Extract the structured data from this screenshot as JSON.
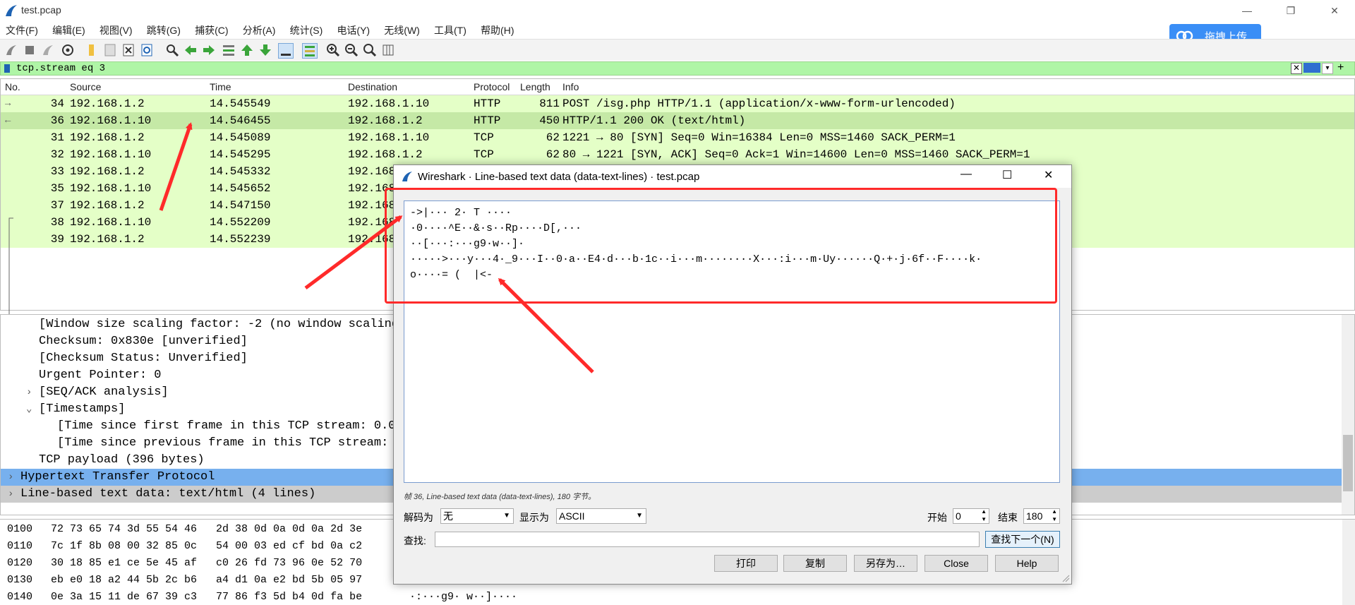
{
  "window": {
    "title": "test.pcap",
    "controls": [
      "—",
      "❐",
      "✕"
    ]
  },
  "menu": [
    "文件(F)",
    "编辑(E)",
    "视图(V)",
    "跳转(G)",
    "捕获(C)",
    "分析(A)",
    "统计(S)",
    "电话(Y)",
    "无线(W)",
    "工具(T)",
    "帮助(H)"
  ],
  "upload_button": "拖拽上传",
  "filter": {
    "value": "tcp.stream eq 3"
  },
  "packet_list": {
    "columns": [
      "No.",
      "Source",
      "Time",
      "Destination",
      "Protocol",
      "Length",
      "Info"
    ],
    "rows": [
      {
        "no": "34",
        "src": "192.168.1.2",
        "time": "14.545549",
        "dst": "192.168.1.10",
        "proto": "HTTP",
        "len": "811",
        "info": "POST /isg.php HTTP/1.1  (application/x-www-form-urlencoded)",
        "marker": "→"
      },
      {
        "no": "36",
        "src": "192.168.1.10",
        "time": "14.546455",
        "dst": "192.168.1.2",
        "proto": "HTTP",
        "len": "450",
        "info": "HTTP/1.1 200 OK  (text/html)",
        "marker": "←"
      },
      {
        "no": "31",
        "src": "192.168.1.2",
        "time": "14.545089",
        "dst": "192.168.1.10",
        "proto": "TCP",
        "len": "62",
        "info": "1221 → 80 [SYN] Seq=0 Win=16384 Len=0 MSS=1460 SACK_PERM=1",
        "marker": ""
      },
      {
        "no": "32",
        "src": "192.168.1.10",
        "time": "14.545295",
        "dst": "192.168.1.2",
        "proto": "TCP",
        "len": "62",
        "info": "80 → 1221 [SYN, ACK] Seq=0 Ack=1 Win=14600 Len=0 MSS=1460 SACK_PERM=1",
        "marker": ""
      },
      {
        "no": "33",
        "src": "192.168.1.2",
        "time": "14.545332",
        "dst": "192.168",
        "proto": "",
        "len": "",
        "info": "",
        "marker": ""
      },
      {
        "no": "35",
        "src": "192.168.1.10",
        "time": "14.545652",
        "dst": "192.168",
        "proto": "",
        "len": "",
        "info": "",
        "marker": ""
      },
      {
        "no": "37",
        "src": "192.168.1.2",
        "time": "14.547150",
        "dst": "192.168",
        "proto": "",
        "len": "",
        "info": "",
        "marker": ""
      },
      {
        "no": "38",
        "src": "192.168.1.10",
        "time": "14.552209",
        "dst": "192.168",
        "proto": "",
        "len": "",
        "info": "",
        "marker": ""
      },
      {
        "no": "39",
        "src": "192.168.1.2",
        "time": "14.552239",
        "dst": "192.168",
        "proto": "",
        "len": "",
        "info": "",
        "marker": ""
      }
    ]
  },
  "details": [
    {
      "text": "[Window size scaling factor: -2 (no window scaling",
      "indent": 1,
      "exp": ""
    },
    {
      "text": "Checksum: 0x830e [unverified]",
      "indent": 1,
      "exp": ""
    },
    {
      "text": "[Checksum Status: Unverified]",
      "indent": 1,
      "exp": ""
    },
    {
      "text": "Urgent Pointer: 0",
      "indent": 1,
      "exp": ""
    },
    {
      "text": "[SEQ/ACK analysis]",
      "indent": 1,
      "exp": ">"
    },
    {
      "text": "[Timestamps]",
      "indent": 1,
      "exp": "v"
    },
    {
      "text": "[Time since first frame in this TCP stream: 0.00",
      "indent": 2,
      "exp": ""
    },
    {
      "text": "[Time since previous frame in this TCP stream: 0",
      "indent": 2,
      "exp": ""
    },
    {
      "text": "TCP payload (396 bytes)",
      "indent": 1,
      "exp": ""
    },
    {
      "text": "Hypertext Transfer Protocol",
      "indent": 0,
      "exp": ">",
      "sel": "blue"
    },
    {
      "text": "Line-based text data: text/html (4 lines)",
      "indent": 0,
      "exp": ">",
      "sel": "gray"
    }
  ],
  "hex": [
    {
      "off": "0100",
      "bytes": "72 73 65 74 3d 55 54 46   2d 38 0d 0a 0d 0a 2d 3e",
      "ascii": ""
    },
    {
      "off": "0110",
      "bytes": "7c 1f 8b 08 00 32 85 0c   54 00 03 ed cf bd 0a c2",
      "ascii": ""
    },
    {
      "off": "0120",
      "bytes": "30 18 85 e1 ce 5e 45 af   c0 26 fd 73 96 0e 52 70",
      "ascii": ""
    },
    {
      "off": "0130",
      "bytes": "eb e0 18 a2 44 5b 2c b6   a4 d1 0a e2 bd 5b 05 97",
      "ascii": ""
    },
    {
      "off": "0140",
      "bytes": "0e 3a 15 11 de 67 39 c3   77 86 f3 5d b4 0d fa be",
      "ascii": "·:···g9· w··]····"
    }
  ],
  "dialog": {
    "title": "Wireshark · Line-based text data (data-text-lines) · test.pcap",
    "lines": [
      "->|··· 2· T ····",
      "·0····^E··&·s··Rp····D[,···",
      "··[···:···g9·w··]·",
      "·····>···y···4·_9···I··0·a··E4·d···b·1c··i···m········X···:i···m·Uy······Q·+·j·6f··F····k·",
      "o····= (  |<-"
    ],
    "status": "帧 36, Line-based text data (data-text-lines), 180 字节。",
    "decode_label": "解码为",
    "decode_value": "无",
    "show_label": "显示为",
    "show_value": "ASCII",
    "start_label": "开始",
    "start_value": "0",
    "end_label": "结束",
    "end_value": "180",
    "find_label": "查找:",
    "find_next": "查找下一个(N)",
    "buttons": [
      "打印",
      "复制",
      "另存为…",
      "Close",
      "Help"
    ]
  },
  "colors": {
    "row_green": "#e4ffc7",
    "selected_row": "#c5e9a6",
    "detail_blue": "#77b0ee",
    "annotation_red": "#ff2a2a"
  }
}
